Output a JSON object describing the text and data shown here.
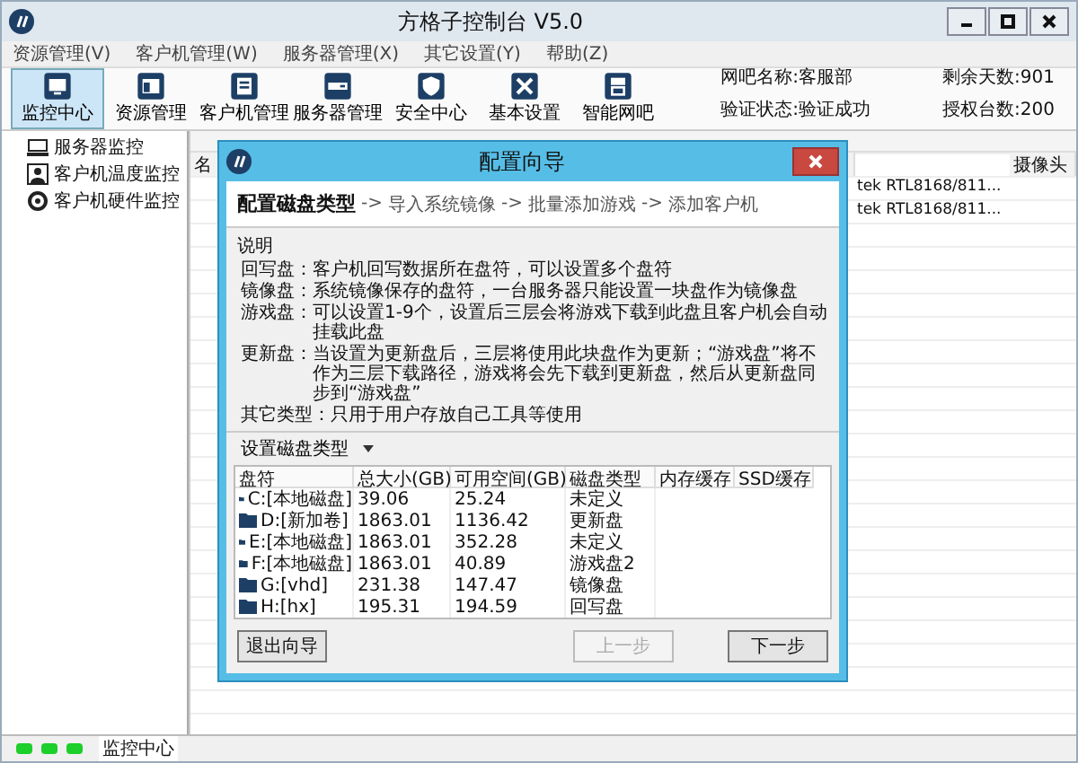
{
  "window": {
    "title": "方格子控制台 V5.0"
  },
  "menu": [
    {
      "label": "资源管理(V)"
    },
    {
      "label": "客户机管理(W)"
    },
    {
      "label": "服务器管理(X)"
    },
    {
      "label": "其它设置(Y)"
    },
    {
      "label": "帮助(Z)"
    }
  ],
  "toolbar": [
    {
      "label": "监控中心",
      "selected": true
    },
    {
      "label": "资源管理",
      "selected": false
    },
    {
      "label": "客户机管理",
      "selected": false
    },
    {
      "label": "服务器管理",
      "selected": false
    },
    {
      "label": "安全中心",
      "selected": false
    },
    {
      "label": "基本设置",
      "selected": false
    },
    {
      "label": "智能网吧",
      "selected": false
    }
  ],
  "info": [
    {
      "label": "网吧名称:客服部",
      "extra": "剩余天数:901"
    },
    {
      "label": "验证状态:验证成功",
      "extra": "授权台数:200"
    }
  ],
  "tree": [
    {
      "label": "服务器监控"
    },
    {
      "label": "客户机温度监控"
    },
    {
      "label": "客户机硬件监控"
    }
  ],
  "background_table": {
    "columns": [
      {
        "label": "名"
      },
      {
        "label": "摄像头"
      }
    ],
    "rows": [
      {
        "network_card": "tek RTL8168/811..."
      },
      {
        "network_card": "tek RTL8168/811..."
      }
    ]
  },
  "dialog": {
    "title": "配置向导",
    "steps": [
      {
        "label": "配置磁盘类型",
        "selected": true
      },
      {
        "prefix": "->",
        "label": "导入系统镜像",
        "selected": false
      },
      {
        "prefix": "->",
        "label": "批量添加游戏",
        "selected": false
      },
      {
        "prefix": "->",
        "label": "添加客户机",
        "selected": false
      }
    ],
    "description": {
      "heading": "说明",
      "lines": [
        {
          "term": "回写盘：",
          "text": "客户机回写数据所在盘符，可以设置多个盘符"
        },
        {
          "term": "镜像盘：",
          "text": "系统镜像保存的盘符，一台服务器只能设置一块盘作为镜像盘"
        },
        {
          "term": "游戏盘：",
          "text": "可以设置1-9个，设置后三层会将游戏下载到此盘且客户机会自动挂载此盘"
        },
        {
          "term": "更新盘：",
          "text": "当设置为更新盘后，三层将使用此块盘作为更新；“游戏盘”将不作为三层下载路径，游戏将会先下载到更新盘，然后从更新盘同步到“游戏盘”"
        },
        {
          "term": "其它类型：",
          "text": "只用于用户存放自己工具等使用"
        }
      ]
    },
    "dropdown": {
      "label": "设置磁盘类型"
    },
    "table": {
      "columns": [
        "盘符",
        "总大小(GB)",
        "可用空间(GB)",
        "磁盘类型",
        "内存缓存",
        "SSD缓存"
      ],
      "rows": [
        {
          "drive": "C:[本地磁盘]",
          "total": "39.06",
          "free": "25.24",
          "type": "未定义"
        },
        {
          "drive": "D:[新加卷]",
          "total": "1863.01",
          "free": "1136.42",
          "type": "更新盘"
        },
        {
          "drive": "E:[本地磁盘]",
          "total": "1863.01",
          "free": "352.28",
          "type": "未定义"
        },
        {
          "drive": "F:[本地磁盘]",
          "total": "1863.01",
          "free": "40.89",
          "type": "游戏盘2"
        },
        {
          "drive": "G:[vhd]",
          "total": "231.38",
          "free": "147.47",
          "type": "镜像盘"
        },
        {
          "drive": "H:[hx]",
          "total": "195.31",
          "free": "194.59",
          "type": "回写盘"
        }
      ]
    },
    "buttons": [
      {
        "label": "退出向导",
        "disabled": false
      },
      {
        "label": "上一步",
        "disabled": true
      },
      {
        "label": "下一步",
        "disabled": false
      }
    ]
  },
  "status_bar": {
    "leds": [
      {
        "on": true
      },
      {
        "on": true
      },
      {
        "on": true
      }
    ],
    "label": "监控中心"
  }
}
